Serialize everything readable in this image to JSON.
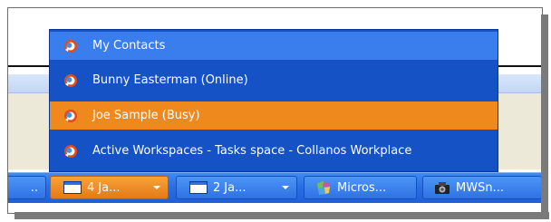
{
  "menu": {
    "items": [
      {
        "label": "My Contacts",
        "icon": "collanos-app-icon"
      },
      {
        "label": "Bunny Easterman (Online)",
        "icon": "collanos-app-icon"
      },
      {
        "label": "Joe Sample (Busy)",
        "icon": "collanos-app-icon"
      },
      {
        "label": "Active Workspaces - Tasks space - Collanos Workplace",
        "icon": "collanos-app-icon"
      }
    ],
    "colors": {
      "background": "#1452c6",
      "highlight": "#3a7ded",
      "selected": "#f0891d"
    }
  },
  "taskbar": {
    "partial_label": "..",
    "buttons": [
      {
        "count": "4",
        "label": "Ja...",
        "icon": "window-icon",
        "state": "active"
      },
      {
        "count": "2",
        "label": "Ja...",
        "icon": "window-icon",
        "state": "normal"
      },
      {
        "label": "Micros...",
        "icon": "visual-studio-icon",
        "state": "normal"
      },
      {
        "label": "MWSn...",
        "icon": "camera-icon",
        "state": "normal"
      }
    ]
  },
  "background_window": {
    "grip_icon": "toolbar-grip-icon"
  }
}
